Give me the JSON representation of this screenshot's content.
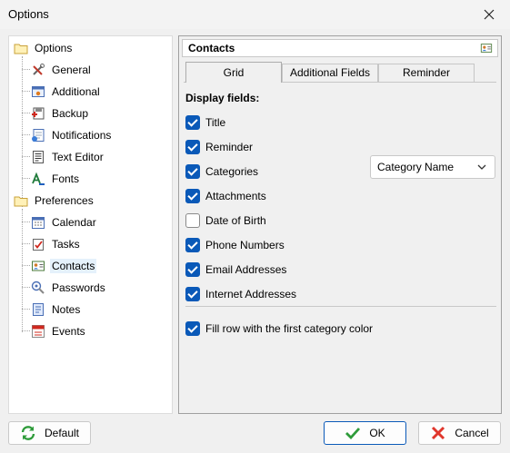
{
  "window": {
    "title": "Options"
  },
  "tree": {
    "groups": [
      {
        "label": "Options",
        "items": [
          "General",
          "Additional",
          "Backup",
          "Notifications",
          "Text Editor",
          "Fonts"
        ]
      },
      {
        "label": "Preferences",
        "items": [
          "Calendar",
          "Tasks",
          "Contacts",
          "Passwords",
          "Notes",
          "Events"
        ]
      }
    ],
    "selected": "Contacts"
  },
  "panel": {
    "title": "Contacts",
    "tabs": [
      "Grid",
      "Additional Fields",
      "Reminder"
    ],
    "active_tab": "Grid",
    "section_title": "Display fields:",
    "fields": [
      {
        "label": "Title",
        "checked": true
      },
      {
        "label": "Reminder",
        "checked": true
      },
      {
        "label": "Categories",
        "checked": true
      },
      {
        "label": "Attachments",
        "checked": true
      },
      {
        "label": "Date of Birth",
        "checked": false
      },
      {
        "label": "Phone Numbers",
        "checked": true
      },
      {
        "label": "Email Addresses",
        "checked": true
      },
      {
        "label": "Internet Addresses",
        "checked": true
      }
    ],
    "category_dropdown": "Category Name",
    "fill_row": {
      "label": "Fill row with the first category color",
      "checked": true
    }
  },
  "buttons": {
    "default": "Default",
    "ok": "OK",
    "cancel": "Cancel"
  },
  "colors": {
    "accent": "#0a59b8",
    "selection": "#e5f1fb"
  }
}
